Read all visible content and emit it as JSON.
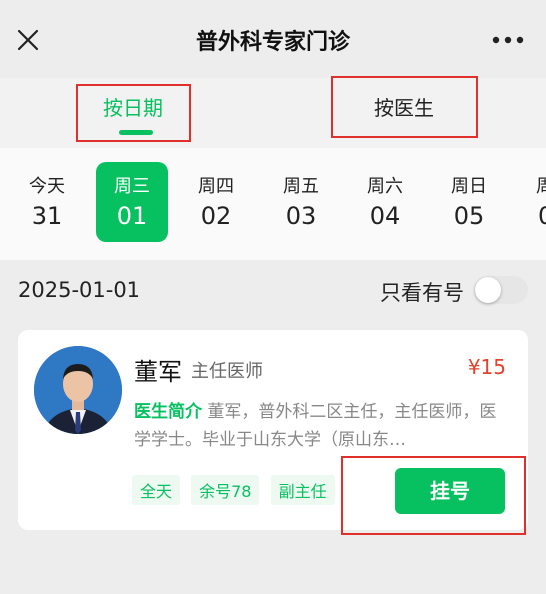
{
  "header": {
    "title": "普外科专家门诊"
  },
  "tabs": [
    {
      "label": "按日期",
      "active": true
    },
    {
      "label": "按医生",
      "active": false
    }
  ],
  "dates": [
    {
      "weekday": "今天",
      "date": "31",
      "selected": false
    },
    {
      "weekday": "周三",
      "date": "01",
      "selected": true
    },
    {
      "weekday": "周四",
      "date": "02",
      "selected": false
    },
    {
      "weekday": "周五",
      "date": "03",
      "selected": false
    },
    {
      "weekday": "周六",
      "date": "04",
      "selected": false
    },
    {
      "weekday": "周日",
      "date": "05",
      "selected": false
    },
    {
      "weekday": "周",
      "date": "0",
      "selected": false
    }
  ],
  "filter": {
    "current_date": "2025-01-01",
    "only_available_label": "只看有号",
    "only_available_on": false
  },
  "doctor_card": {
    "name": "董军",
    "title": "主任医师",
    "fee": "¥15",
    "intro_label": "医生简介",
    "intro_text": "董军，普外科二区主任，主任医师，医学学士。毕业于山东大学（原山东…",
    "tags": [
      "全天",
      "余号78",
      "副主任"
    ],
    "register_label": "挂号"
  },
  "colors": {
    "accent": "#07c160",
    "price": "#e2432f",
    "annotation_box": "#e0302b"
  },
  "icons": {
    "close": "close-icon",
    "more": "more-icon"
  }
}
